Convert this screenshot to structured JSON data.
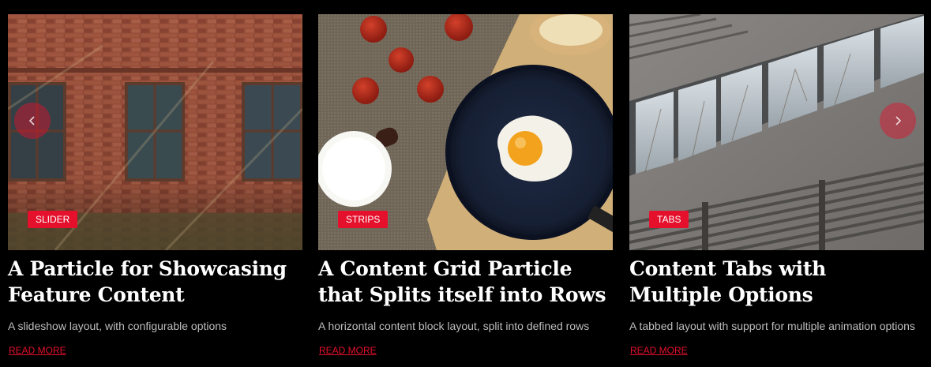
{
  "cards": [
    {
      "badge": "SLIDER",
      "title": "A Particle for Showcasing Feature Content",
      "description": "A slideshow layout, with configurable options",
      "link": "READ MORE",
      "image_icon": "brick-wall-windows-image"
    },
    {
      "badge": "STRIPS",
      "title": "A Content Grid Particle that Splits itself into Rows",
      "description": "A horizontal content block layout, split into defined rows",
      "link": "READ MORE",
      "image_icon": "fried-egg-pan-image"
    },
    {
      "badge": "TABS",
      "title": "Content Tabs with Multiple Options",
      "description": "A tabbed layout with support for multiple animation options",
      "link": "READ MORE",
      "image_icon": "concrete-building-image"
    }
  ],
  "navigation": {
    "prev_icon": "chevron-left-icon",
    "next_icon": "chevron-right-icon"
  },
  "colors": {
    "accent": "#e4102c",
    "background": "#000000",
    "description": "#bdbdbd"
  }
}
